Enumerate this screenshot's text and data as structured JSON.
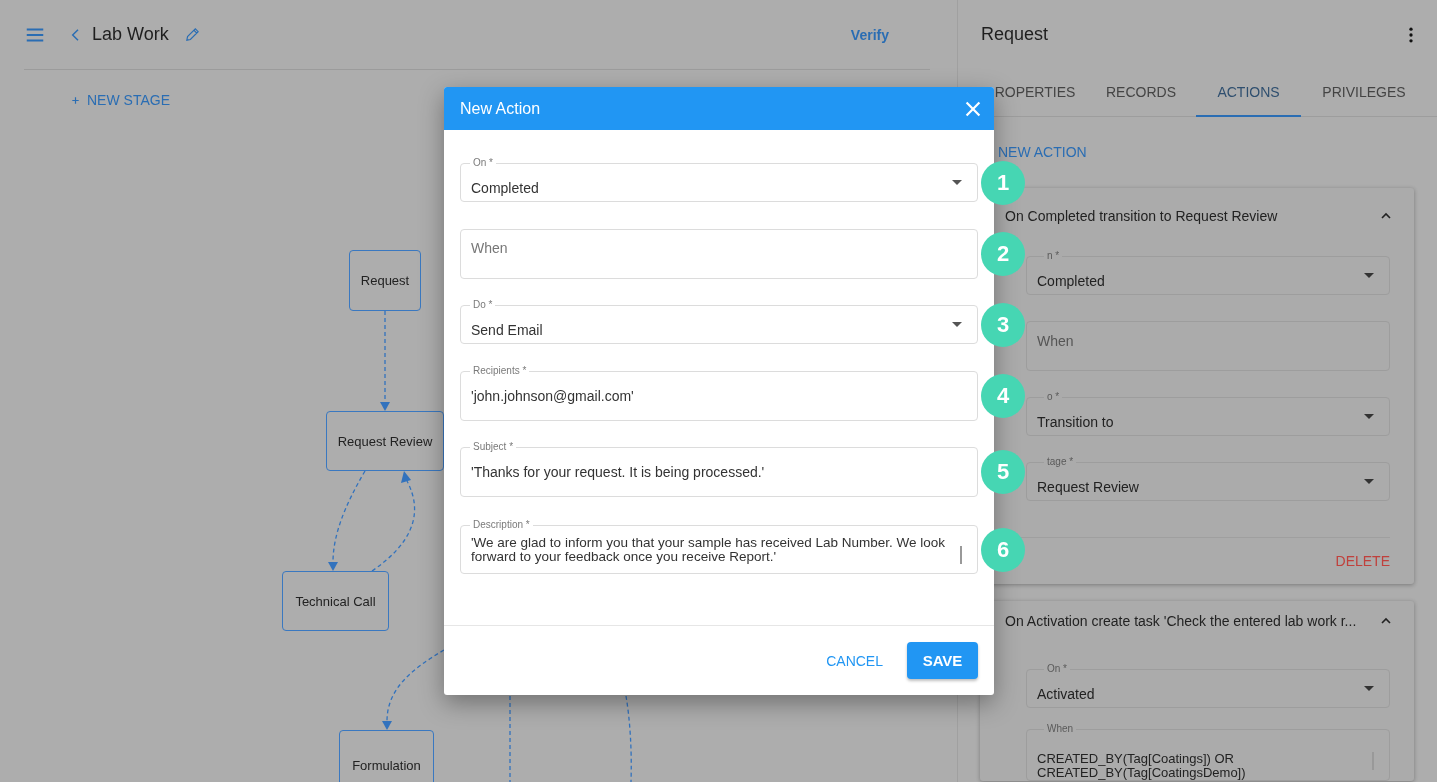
{
  "app_bar": {
    "title": "Lab Work",
    "action": "Verify"
  },
  "new_stage": {
    "label": "NEW STAGE"
  },
  "diagram": {
    "nodes": [
      {
        "label": "Request"
      },
      {
        "label": "Request Review"
      },
      {
        "label": "Technical Call"
      },
      {
        "label": "Formulation"
      }
    ]
  },
  "panel": {
    "title": "Request",
    "tabs": [
      {
        "label": "ROPERTIES",
        "selected": false
      },
      {
        "label": "RECORDS",
        "selected": false
      },
      {
        "label": "ACTIONS",
        "selected": true
      },
      {
        "label": "PRIVILEGES",
        "selected": false
      }
    ],
    "new_action": "NEW ACTION",
    "actions": [
      {
        "title": "On Completed transition to Request Review",
        "expanded": true,
        "fields": [
          {
            "kind": "select",
            "label": "n *",
            "value": "Completed"
          },
          {
            "kind": "text",
            "placeholder": "When"
          },
          {
            "kind": "select",
            "label": "o *",
            "value": "Transition to"
          },
          {
            "kind": "select",
            "label": "tage *",
            "value": "Request Review"
          }
        ],
        "delete": "DELETE"
      },
      {
        "title": "On Activation create task 'Check the entered lab work r...",
        "expanded": true,
        "fields": [
          {
            "kind": "select",
            "label": "On *",
            "value": "Activated"
          },
          {
            "kind": "textarea",
            "label": "When",
            "value": "CREATED_BY(Tag[Coatings]) OR\nCREATED_BY(Tag[CoatingsDemo])"
          }
        ]
      }
    ]
  },
  "modal": {
    "title": "New Action",
    "fields": [
      {
        "kind": "select",
        "label": "On *",
        "value": "Completed",
        "marker": "1"
      },
      {
        "kind": "text",
        "placeholder": "When",
        "marker": "2"
      },
      {
        "kind": "select",
        "label": "Do *",
        "value": "Send Email",
        "marker": "3"
      },
      {
        "kind": "text",
        "label": "Recipients *",
        "value": "'john.johnson@gmail.com'",
        "marker": "4"
      },
      {
        "kind": "text",
        "label": "Subject *",
        "value": "'Thanks for your request. It is being processed.'",
        "marker": "5"
      },
      {
        "kind": "textarea",
        "label": "Description *",
        "value": "'We are glad to inform you that your sample has received Lab Number. We look forward to your feedback once you receive Report.'",
        "marker": "6"
      }
    ],
    "buttons": [
      {
        "kind": "text",
        "label": "CANCEL"
      },
      {
        "kind": "contained",
        "label": "SAVE"
      }
    ]
  }
}
